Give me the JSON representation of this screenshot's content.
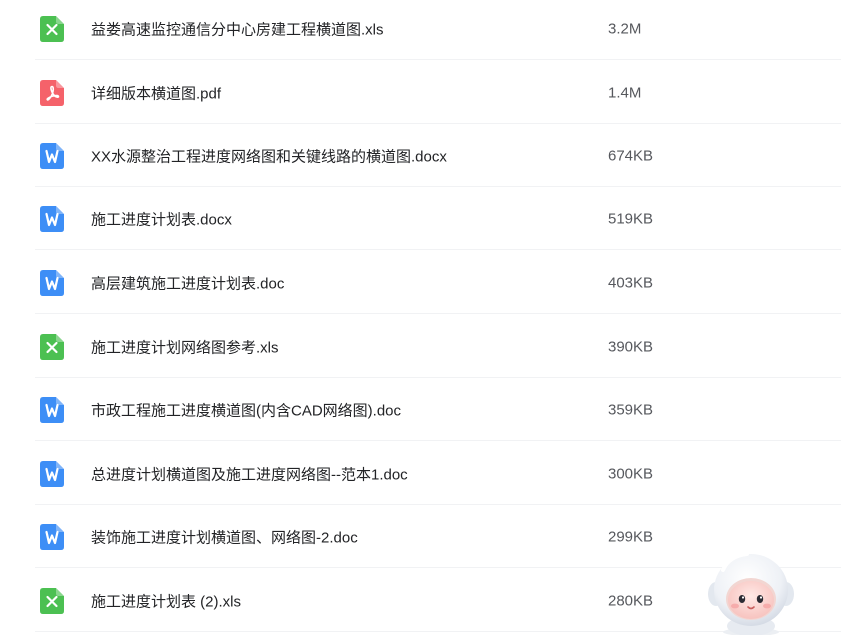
{
  "files": [
    {
      "name": "益娄高速监控通信分中心房建工程横道图.xls",
      "size": "3.2M",
      "type": "xls",
      "icon": "excel-file-icon"
    },
    {
      "name": "详细版本横道图.pdf",
      "size": "1.4M",
      "type": "pdf",
      "icon": "pdf-file-icon"
    },
    {
      "name": "XX水源整治工程进度网络图和关键线路的横道图.docx",
      "size": "674KB",
      "type": "doc",
      "icon": "word-file-icon"
    },
    {
      "name": "施工进度计划表.docx",
      "size": "519KB",
      "type": "doc",
      "icon": "word-file-icon"
    },
    {
      "name": "高层建筑施工进度计划表.doc",
      "size": "403KB",
      "type": "doc",
      "icon": "word-file-icon"
    },
    {
      "name": "施工进度计划网络图参考.xls",
      "size": "390KB",
      "type": "xls",
      "icon": "excel-file-icon"
    },
    {
      "name": "市政工程施工进度横道图(内含CAD网络图).doc",
      "size": "359KB",
      "type": "doc",
      "icon": "word-file-icon"
    },
    {
      "name": "总进度计划横道图及施工进度网络图--范本1.doc",
      "size": "300KB",
      "type": "doc",
      "icon": "word-file-icon"
    },
    {
      "name": "装饰施工进度计划横道图、网络图-2.doc",
      "size": "299KB",
      "type": "doc",
      "icon": "word-file-icon"
    },
    {
      "name": "施工进度计划表 (2).xls",
      "size": "280KB",
      "type": "xls",
      "icon": "excel-file-icon"
    }
  ],
  "colors": {
    "xls": "#4cc052",
    "pdf": "#f5626a",
    "doc": "#3d8ef6",
    "name_text": "#222326",
    "size_text": "#56585d",
    "divider": "#f1f2f4"
  },
  "mascot": {
    "icon": "assistant-mascot-icon"
  }
}
